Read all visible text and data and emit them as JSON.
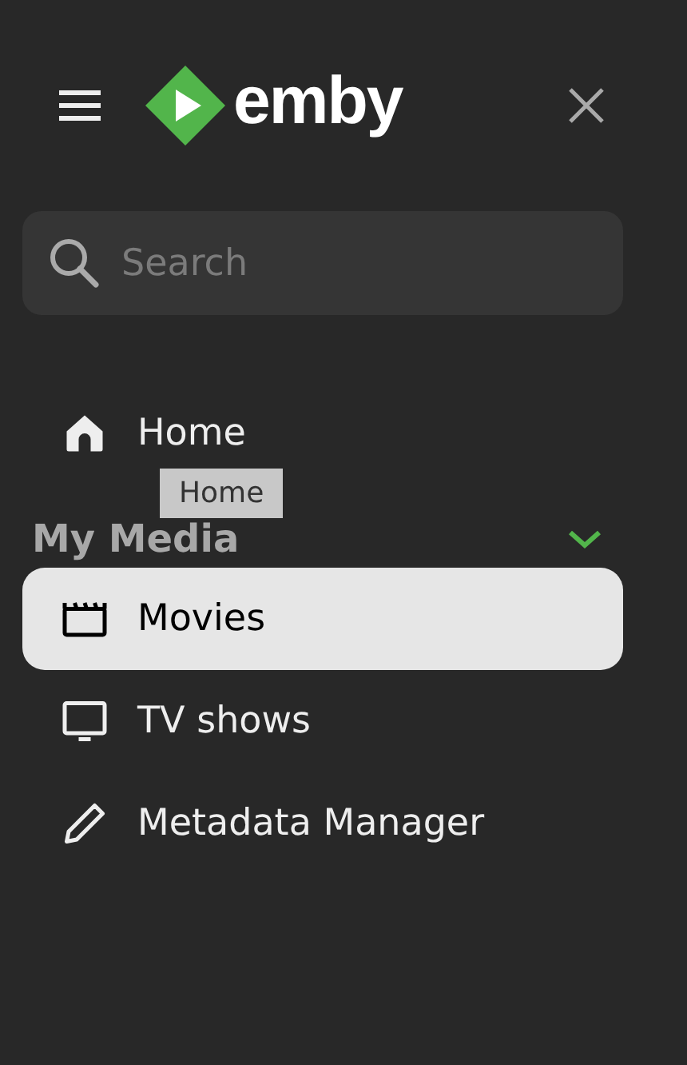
{
  "header": {
    "logo_text": "emby"
  },
  "search": {
    "placeholder": "Search"
  },
  "nav": [
    {
      "kind": "home",
      "label": "Home",
      "selected": false
    }
  ],
  "tooltip": {
    "text": "Home"
  },
  "section": {
    "title": "My Media",
    "expanded": true,
    "items": [
      {
        "kind": "movies",
        "label": "Movies",
        "selected": true
      },
      {
        "kind": "tv",
        "label": "TV shows",
        "selected": false
      },
      {
        "kind": "edit",
        "label": "Metadata Manager",
        "selected": false
      }
    ]
  }
}
